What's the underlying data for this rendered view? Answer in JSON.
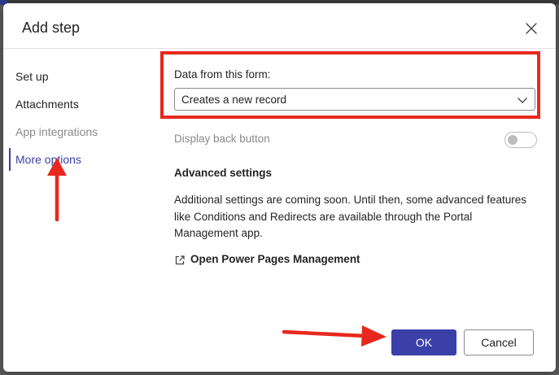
{
  "dialog": {
    "title": "Add step",
    "close_icon": "close-icon"
  },
  "nav": {
    "items": [
      {
        "label": "Set up",
        "state": "normal"
      },
      {
        "label": "Attachments",
        "state": "normal"
      },
      {
        "label": "App integrations",
        "state": "disabled"
      },
      {
        "label": "More options",
        "state": "selected"
      }
    ]
  },
  "form": {
    "data_label": "Data from this form:",
    "data_value": "Creates a new record",
    "back_button_label": "Display back button",
    "back_button_enabled": false,
    "advanced_title": "Advanced settings",
    "advanced_text": "Additional settings are coming soon. Until then, some advanced features like Conditions and Redirects are available through the Portal Management app.",
    "link_label": "Open Power Pages Management",
    "link_icon": "open-external-icon"
  },
  "footer": {
    "ok_label": "OK",
    "cancel_label": "Cancel"
  },
  "colors": {
    "accent": "#3b3fa8",
    "annotation": "#e8281e"
  }
}
